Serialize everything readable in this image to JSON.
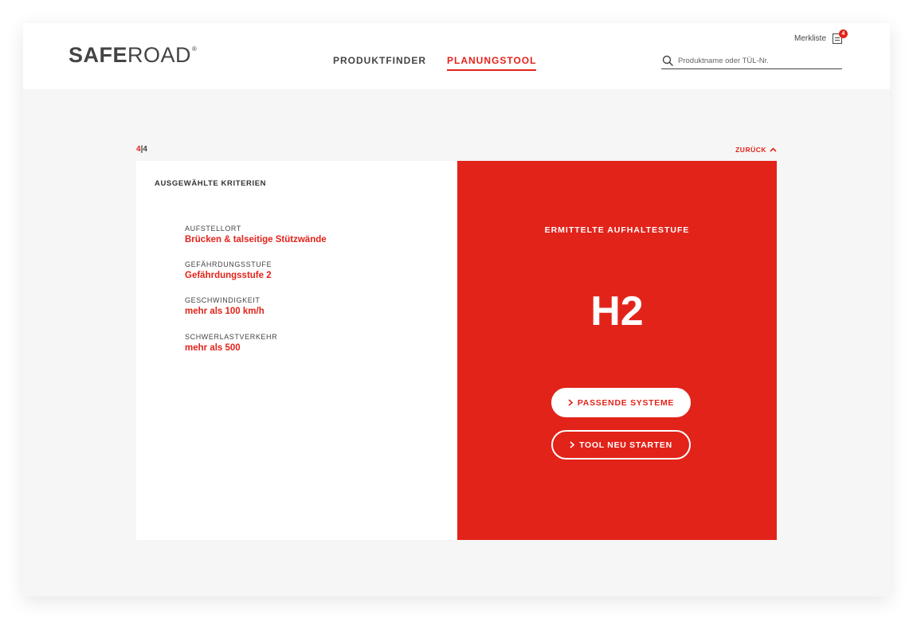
{
  "brand": {
    "bold": "SAFE",
    "light": "ROAD",
    "mark": "®"
  },
  "nav": {
    "items": [
      {
        "label": "PRODUKTFINDER"
      },
      {
        "label": "PLANUNGSTOOL"
      }
    ]
  },
  "header": {
    "watchlist_label": "Merkliste",
    "watchlist_count": "4",
    "search_placeholder": "Produktname oder TÜL-Nr."
  },
  "progress": {
    "current": "4",
    "separator": "|",
    "total": "4"
  },
  "back_label": "ZURÜCK",
  "selected": {
    "title": "AUSGEWÄHLTE KRITERIEN",
    "criteria": [
      {
        "label": "AUFSTELLORT",
        "value": "Brücken & talseitige Stützwände"
      },
      {
        "label": "GEFÄHRDUNGSSTUFE",
        "value": "Gefährdungsstufe 2"
      },
      {
        "label": "GESCHWINDIGKEIT",
        "value": "mehr als 100 km/h"
      },
      {
        "label": "SCHWERLASTVERKEHR",
        "value": "mehr als 500"
      }
    ]
  },
  "result": {
    "title": "ERMITTELTE AUFHALTESTUFE",
    "value": "H2",
    "primary_button": "PASSENDE SYSTEME",
    "secondary_button": "TOOL NEU STARTEN"
  },
  "colors": {
    "accent": "#e2231a",
    "background": "#f6f6f6",
    "text": "#444444"
  }
}
